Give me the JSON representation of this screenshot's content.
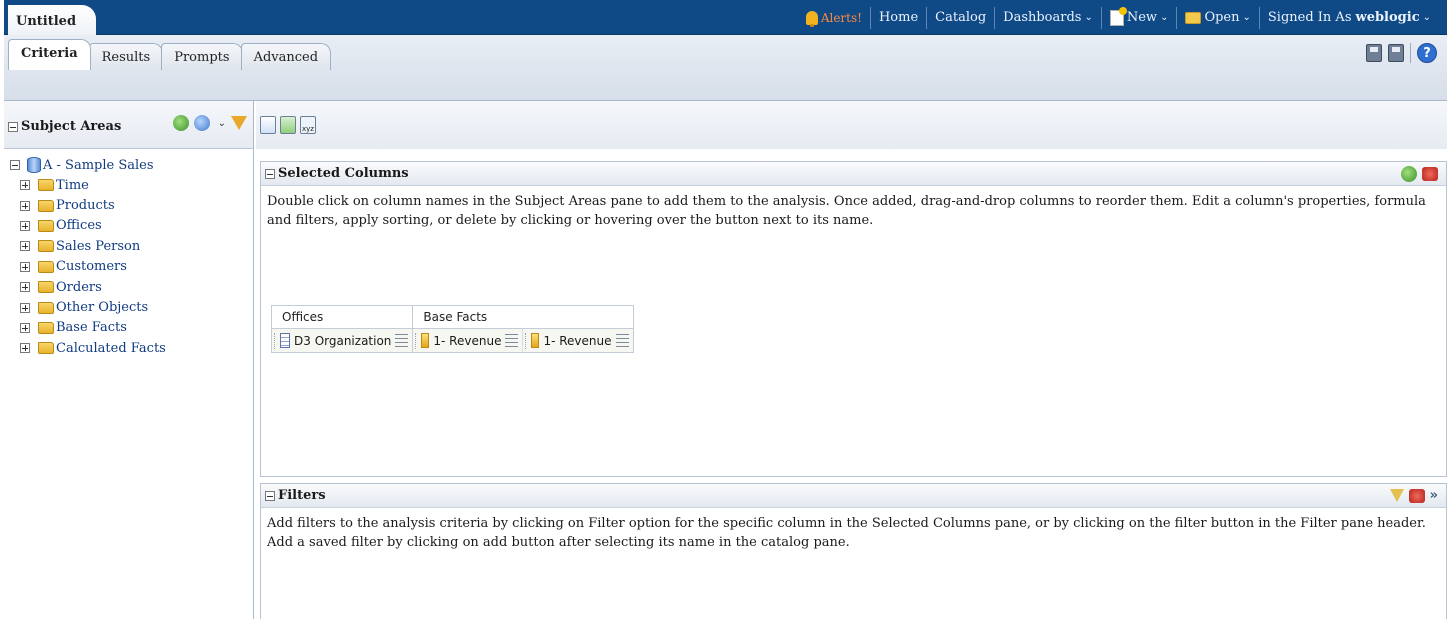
{
  "header": {
    "title_tab": "Untitled",
    "alerts_label": "Alerts!",
    "home_label": "Home",
    "catalog_label": "Catalog",
    "dashboards_label": "Dashboards",
    "new_label": "New",
    "open_label": "Open",
    "signed_in_label": "Signed In As",
    "username": "weblogic"
  },
  "tabs": [
    {
      "label": "Criteria",
      "active": true
    },
    {
      "label": "Results",
      "active": false
    },
    {
      "label": "Prompts",
      "active": false
    },
    {
      "label": "Advanced",
      "active": false
    }
  ],
  "subject_areas": {
    "title": "Subject Areas",
    "root": "A - Sample Sales",
    "folders": [
      "Time",
      "Products",
      "Offices",
      "Sales Person",
      "Customers",
      "Orders",
      "Other Objects",
      "Base Facts",
      "Calculated Facts"
    ]
  },
  "selected_columns": {
    "title": "Selected Columns",
    "description": "Double click on column names in the Subject Areas pane to add them to the analysis. Once added, drag-and-drop columns to reorder them. Edit a column's properties, formula and filters, apply sorting, or delete by clicking or hovering over the button next to its name.",
    "groups": [
      {
        "name": "Offices",
        "columns": [
          {
            "label": "D3 Organization",
            "type": "attribute"
          }
        ]
      },
      {
        "name": "Base Facts",
        "columns": [
          {
            "label": "1- Revenue",
            "type": "measure"
          },
          {
            "label": "1- Revenue",
            "type": "measure"
          }
        ]
      }
    ]
  },
  "filters": {
    "title": "Filters",
    "description": "Add filters to the analysis criteria by clicking on Filter option for the specific column in the Selected Columns pane, or by clicking on the filter button in the Filter pane header. Add a saved filter by clicking on add button after selecting its name in the catalog pane."
  },
  "colors": {
    "header_bg": "#0f4a86",
    "alerts": "#ff8a3d",
    "tree_link": "#113b80"
  }
}
